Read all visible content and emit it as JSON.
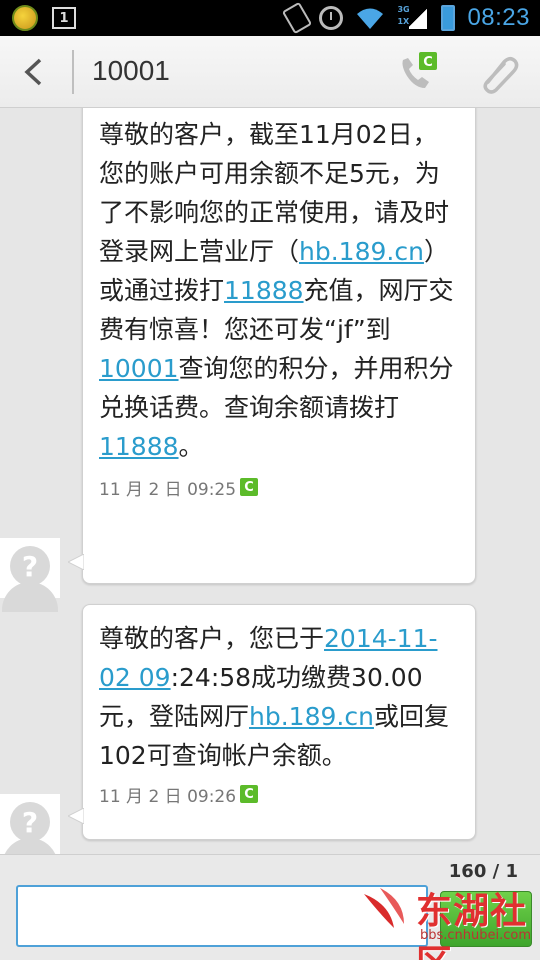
{
  "status_bar": {
    "sim_label": "1",
    "net_top": "3G",
    "net_bottom": "1X",
    "time": "08:23",
    "colors": {
      "accent": "#4aa6e6"
    }
  },
  "header": {
    "title": "10001",
    "icons": [
      "back-arrow-icon",
      "call-icon",
      "attachment-icon"
    ]
  },
  "messages": [
    {
      "segments": [
        {
          "text": "尊敬的客户，截至11月02日，您的账户可用余额不足5元，为了不影响您的正常使用，请及时登录网上营业厅（",
          "link": false
        },
        {
          "text": "hb.189.cn",
          "link": true
        },
        {
          "text": "）或通过拨打",
          "link": false
        },
        {
          "text": "11888",
          "link": true
        },
        {
          "text": "充值，网厅交费有惊喜！您还可发“jf”到",
          "link": false
        },
        {
          "text": "10001",
          "link": true
        },
        {
          "text": "查询您的积分，并用积分兑换话费。查询余额请拨打",
          "link": false
        },
        {
          "text": "11888",
          "link": true
        },
        {
          "text": "。",
          "link": false
        }
      ],
      "time": "11 月 2 日 09:25",
      "badge": "C"
    },
    {
      "segments": [
        {
          "text": "尊敬的客户，您已于",
          "link": false
        },
        {
          "text": "2014-11-02 09",
          "link": true
        },
        {
          "text": ":24:58成功缴费30.00元，登陆网厅",
          "link": false
        },
        {
          "text": "hb.189.cn",
          "link": true
        },
        {
          "text": "或回复102可查询帐户余额。",
          "link": false
        }
      ],
      "time": "11 月 2 日 09:26",
      "badge": "C"
    }
  ],
  "composer": {
    "counter": "160 / 1",
    "input_value": "",
    "call_badge": "C"
  },
  "watermark": {
    "text": "东湖社区",
    "url": "bbs.cnhubei.com"
  }
}
